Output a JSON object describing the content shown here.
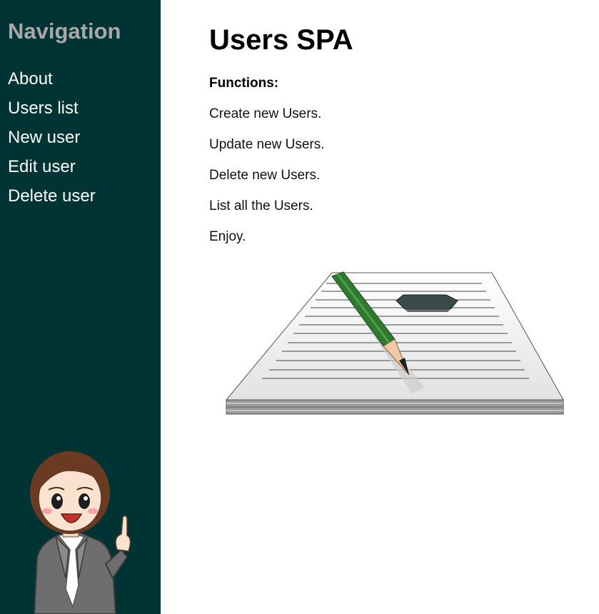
{
  "sidebar": {
    "title": "Navigation",
    "items": [
      {
        "label": "About"
      },
      {
        "label": "Users list"
      },
      {
        "label": "New user"
      },
      {
        "label": "Edit user"
      },
      {
        "label": "Delete user"
      }
    ]
  },
  "main": {
    "title": "Users SPA",
    "functions_label": "Functions:",
    "lines": [
      "Create new Users.",
      "Update new Users.",
      "Delete new Users.",
      "List all the Users.",
      "Enjoy."
    ]
  },
  "colors": {
    "sidebar_bg": "#003333",
    "nav_title": "#a8a8a8",
    "nav_link": "#ffffff"
  }
}
